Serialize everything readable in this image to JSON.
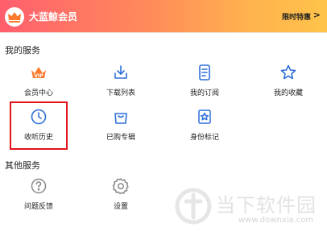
{
  "vip_banner": {
    "title": "大蓝鲸会员",
    "link_label": "限时特惠",
    "arrow_icon": "chevron-right-icon"
  },
  "my_services": {
    "title": "我的服务",
    "items": [
      {
        "label": "会员中心",
        "icon": "vip-crown-icon"
      },
      {
        "label": "下载列表",
        "icon": "download-icon"
      },
      {
        "label": "我的订阅",
        "icon": "document-icon"
      },
      {
        "label": "我的收藏",
        "icon": "star-icon"
      },
      {
        "label": "收听历史",
        "icon": "clock-icon"
      },
      {
        "label": "已购专辑",
        "icon": "shopping-bag-icon"
      },
      {
        "label": "身份标记",
        "icon": "id-star-icon"
      }
    ]
  },
  "other_services": {
    "title": "其他服务",
    "items": [
      {
        "label": "问题反馈",
        "icon": "question-icon"
      },
      {
        "label": "设置",
        "icon": "gear-icon"
      }
    ]
  },
  "watermark": {
    "text": "当下软件园",
    "url": "www.downxia.com"
  },
  "colors": {
    "accent_blue": "#2e6fd8",
    "vip_orange": "#ff7a2e",
    "highlight_red": "#e0141b",
    "banner_start": "#ff5f6d",
    "banner_end": "#ffc44a"
  }
}
